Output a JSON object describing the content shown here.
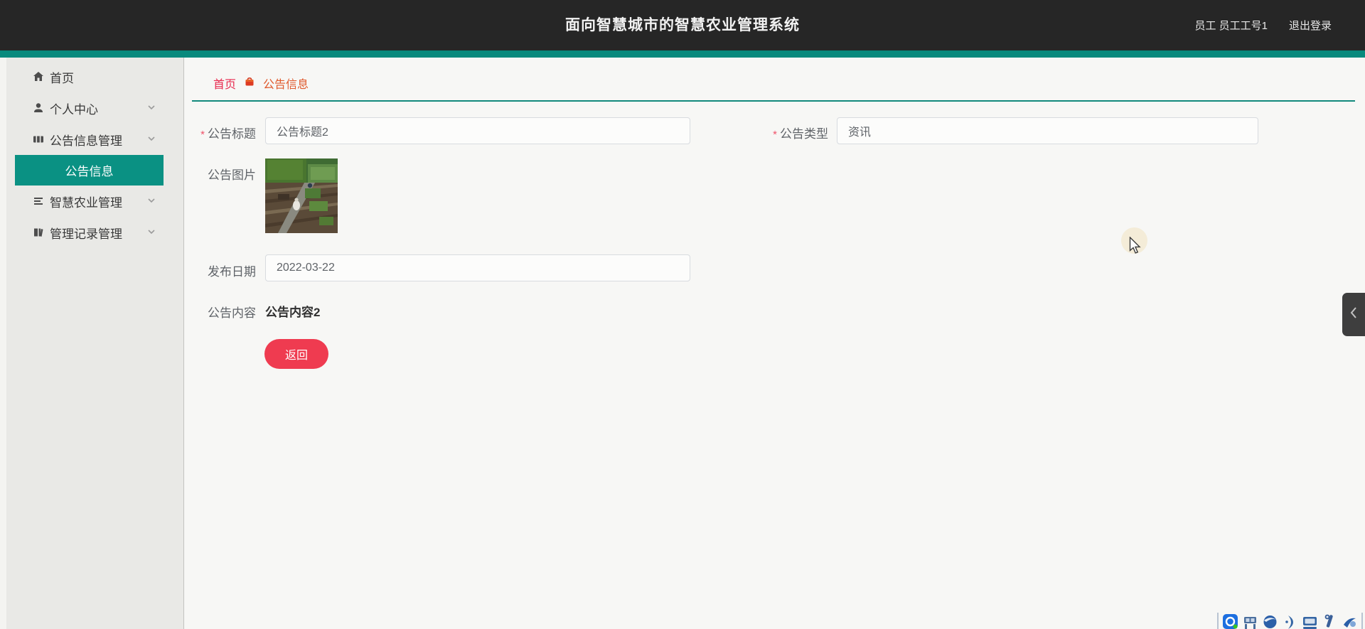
{
  "header": {
    "title": "面向智慧城市的智慧农业管理系统",
    "user": "员工 员工工号1",
    "logout": "退出登录"
  },
  "sidebar": {
    "items": [
      {
        "label": "首页",
        "icon": "home-icon",
        "has_chevron": false
      },
      {
        "label": "个人中心",
        "icon": "user-icon",
        "has_chevron": true
      },
      {
        "label": "公告信息管理",
        "icon": "announcement-icon",
        "has_chevron": true
      },
      {
        "label": "智慧农业管理",
        "icon": "list-icon",
        "has_chevron": true
      },
      {
        "label": "管理记录管理",
        "icon": "records-icon",
        "has_chevron": true
      }
    ],
    "active_subitem": "公告信息"
  },
  "breadcrumb": {
    "home": "首页",
    "current": "公告信息"
  },
  "form": {
    "required_mark": "*",
    "title": {
      "label": "公告标题",
      "value": "公告标题2",
      "required": true
    },
    "type": {
      "label": "公告类型",
      "value": "资讯",
      "required": true
    },
    "image": {
      "label": "公告图片"
    },
    "date": {
      "label": "发布日期",
      "value": "2022-03-22"
    },
    "content": {
      "label": "公告内容",
      "value": "公告内容2"
    },
    "back_button": "返回"
  },
  "icons": {
    "home-icon": "house",
    "user-icon": "person silhouette",
    "announcement-icon": "film/ticket block",
    "list-icon": "horizontal lines list",
    "records-icon": "book/ledger",
    "chevron-down-icon": "∨",
    "breadcrumb-separator-icon": "small red basket",
    "chevron-left-icon": "‹",
    "tray": [
      "app",
      "devices",
      "globe",
      "crescent",
      "disk",
      "tools",
      "pointer"
    ]
  },
  "colors": {
    "header_bg": "#262626",
    "accent_teal": "#088a7d",
    "active_menu_teal": "#0a9183",
    "breadcrumb_home": "#e8294e",
    "breadcrumb_current": "#e05a2d",
    "danger_red": "#ef3b50",
    "sidebar_bg": "#e9e9e6",
    "content_bg": "#f7f7f5"
  }
}
